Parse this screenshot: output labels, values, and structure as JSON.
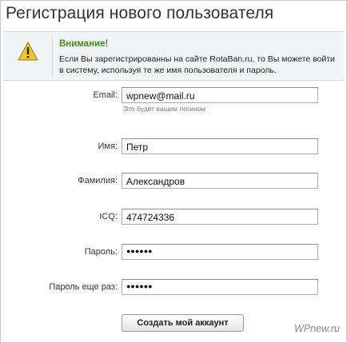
{
  "page": {
    "title": "Регистрация нового пользователя"
  },
  "notice": {
    "icon": "warning-triangle-icon",
    "heading": "Внимание!",
    "text": "Если Вы зарегистрированны на сайте RotaBan.ru, то Вы можете войти в систему, используя те же имя пользователя и пароль."
  },
  "form": {
    "email": {
      "label": "Email:",
      "value": "wpnew@mail.ru",
      "hint": "Это будет вашим логином"
    },
    "first_name": {
      "label": "Имя:",
      "value": "Петр"
    },
    "last_name": {
      "label": "Фамилия:",
      "value": "Александров"
    },
    "icq": {
      "label": "ICQ:",
      "value": "474724336"
    },
    "password": {
      "label": "Пароль:",
      "value": "●●●●●●"
    },
    "password_repeat": {
      "label": "Пароль еще раз:",
      "value": "●●●●●●"
    },
    "submit_label": "Создать мой аккаунт"
  },
  "watermark": "WPnew.ru",
  "colors": {
    "notice_heading": "#3b8b1e",
    "warning_fill": "#f3c623"
  }
}
